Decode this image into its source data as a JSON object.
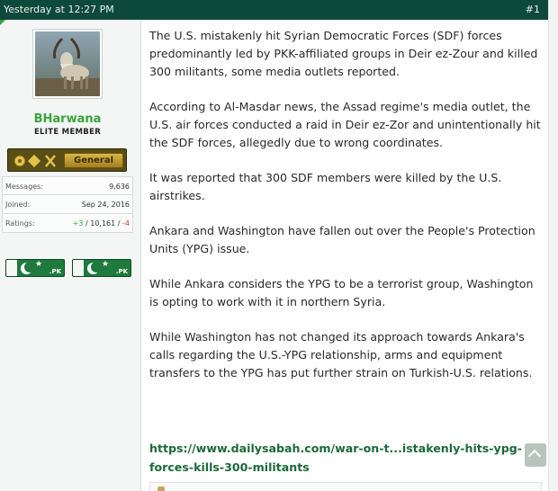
{
  "header": {
    "date": "Yesterday at 12:27 PM",
    "post_number": "#1"
  },
  "author": {
    "username": "BHarwana",
    "title": "ELITE MEMBER",
    "rank_label": "General",
    "stats": {
      "messages_label": "Messages:",
      "messages": "9,636",
      "joined_label": "Joined:",
      "joined": "Sep 24, 2016",
      "ratings_label": "Ratings:",
      "ratings_pos": "+3",
      "ratings_sep1": " / ",
      "ratings_total": "10,161",
      "ratings_sep2": " / ",
      "ratings_neg": "-4"
    },
    "badges": [
      {
        "label": ".PK"
      },
      {
        "label": ".PK"
      }
    ]
  },
  "post": {
    "paragraphs": [
      "The U.S. mistakenly hit Syrian Democratic Forces (SDF) forces predominantly led by PKK-affiliated groups in Deir ez-Zour and killed 300 militants, some media outlets reported.",
      "According to Al-Masdar news, the Assad regime's media outlet, the U.S. air forces conducted a raid in Deir ez-Zor and unintentionally hit the SDF forces, allegedly due to wrong coordinates.",
      "It was reported that 300 SDF members were killed by the U.S. airstrikes.",
      "Ankara and Washington have fallen out over the People's Protection Units (YPG) issue.",
      "While Ankara considers the YPG to be a terrorist group, Washington is opting to work with it in northern Syria.",
      "While Washington has not changed its approach towards Ankara's calls regarding the U.S.-YPG relationship, arms and equipment transfers to the YPG has put further strain on Turkish-U.S. relations."
    ],
    "link_text": "https://www.dailysabah.com/war-on-t...istakenly-hits-ypg-forces-kills-300-militants"
  },
  "icons": {
    "scroll_top": "chevron-up-icon",
    "avatar": "markhor-goat-avatar",
    "badge": "pakistan-flag-icon"
  },
  "colors": {
    "header_bg": "#0d4a3b",
    "username": "#3aa43a",
    "link": "#1a6a3a",
    "positive": "#3aa43a",
    "negative": "#d03a2a"
  }
}
